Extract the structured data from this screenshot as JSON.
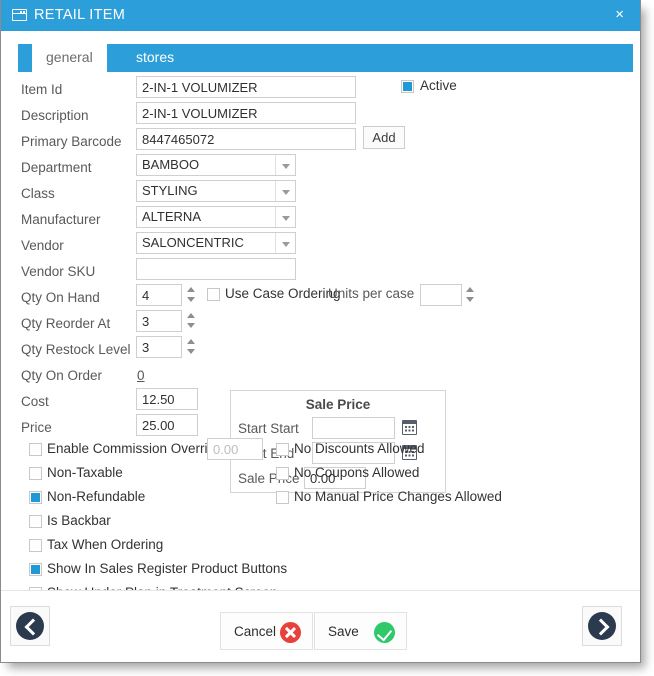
{
  "window": {
    "title": "RETAIL ITEM",
    "icon": "window-icon",
    "close_label": "×"
  },
  "tabs": [
    {
      "id": "general",
      "label": "general",
      "active": true
    },
    {
      "id": "stores",
      "label": "stores",
      "active": false
    }
  ],
  "form": {
    "item_id": {
      "label": "Item Id",
      "value": "2-IN-1 VOLUMIZER"
    },
    "description": {
      "label": "Description",
      "value": "2-IN-1 VOLUMIZER"
    },
    "primary_barcode": {
      "label": "Primary Barcode",
      "value": "8447465072"
    },
    "add_button": {
      "label": "Add"
    },
    "department": {
      "label": "Department",
      "value": "BAMBOO"
    },
    "class": {
      "label": "Class",
      "value": "STYLING"
    },
    "manufacturer": {
      "label": "Manufacturer",
      "value": "ALTERNA"
    },
    "vendor": {
      "label": "Vendor",
      "value": "SALONCENTRIC"
    },
    "vendor_sku": {
      "label": "Vendor SKU",
      "value": ""
    },
    "qty_on_hand": {
      "label": "Qty On Hand",
      "value": "4"
    },
    "qty_reorder_at": {
      "label": "Qty Reorder At",
      "value": "3"
    },
    "qty_restock": {
      "label": "Qty Restock Level",
      "value": "3"
    },
    "qty_on_order": {
      "label": "Qty On Order",
      "value": "0"
    },
    "cost": {
      "label": "Cost",
      "value": "12.50"
    },
    "price": {
      "label": "Price",
      "value": "25.00"
    },
    "active": {
      "label": "Active",
      "checked": true
    },
    "use_case_ordering": {
      "label": "Use Case Ordering",
      "checked": false
    },
    "units_per_case": {
      "label": "Units per case",
      "value": ""
    }
  },
  "sale_price": {
    "title": "Sale Price",
    "start_start": {
      "label": "Start Start",
      "value": ""
    },
    "start_end": {
      "label": "Start End",
      "value": ""
    },
    "sale_price": {
      "label": "Sale Price",
      "value": "0.00"
    }
  },
  "options_left": [
    {
      "id": "enable-commission-override",
      "label": "Enable Commission Override",
      "checked": false,
      "amount": "0.00"
    },
    {
      "id": "non-taxable",
      "label": "Non-Taxable",
      "checked": false
    },
    {
      "id": "non-refundable",
      "label": "Non-Refundable",
      "checked": true
    },
    {
      "id": "is-backbar",
      "label": "Is Backbar",
      "checked": false
    },
    {
      "id": "tax-when-ordering",
      "label": "Tax When Ordering",
      "checked": false
    },
    {
      "id": "show-in-sales-register-product-buttons",
      "label": "Show In Sales Register Product Buttons",
      "checked": true
    },
    {
      "id": "show-under-plan-in-treatment-screen",
      "label": "Show Under Plan in Treatment Screen",
      "checked": false
    }
  ],
  "options_right": [
    {
      "id": "no-discounts-allowed",
      "label": "No Discounts Allowed",
      "checked": false
    },
    {
      "id": "no-coupons-allowed",
      "label": "No Coupons Allowed",
      "checked": false
    },
    {
      "id": "no-manual-price-changes-allowed",
      "label": "No Manual Price Changes Allowed",
      "checked": false
    }
  ],
  "footer": {
    "cancel_label": "Cancel",
    "save_label": "Save",
    "prev_label": "previous-record",
    "next_label": "next-record"
  },
  "colors": {
    "accent": "#2c9fda",
    "checkbox_fill": "#1f9ad6",
    "cancel_badge": "#e8413c",
    "save_badge": "#2fc96a",
    "nav_circle": "#2b3a4f"
  }
}
